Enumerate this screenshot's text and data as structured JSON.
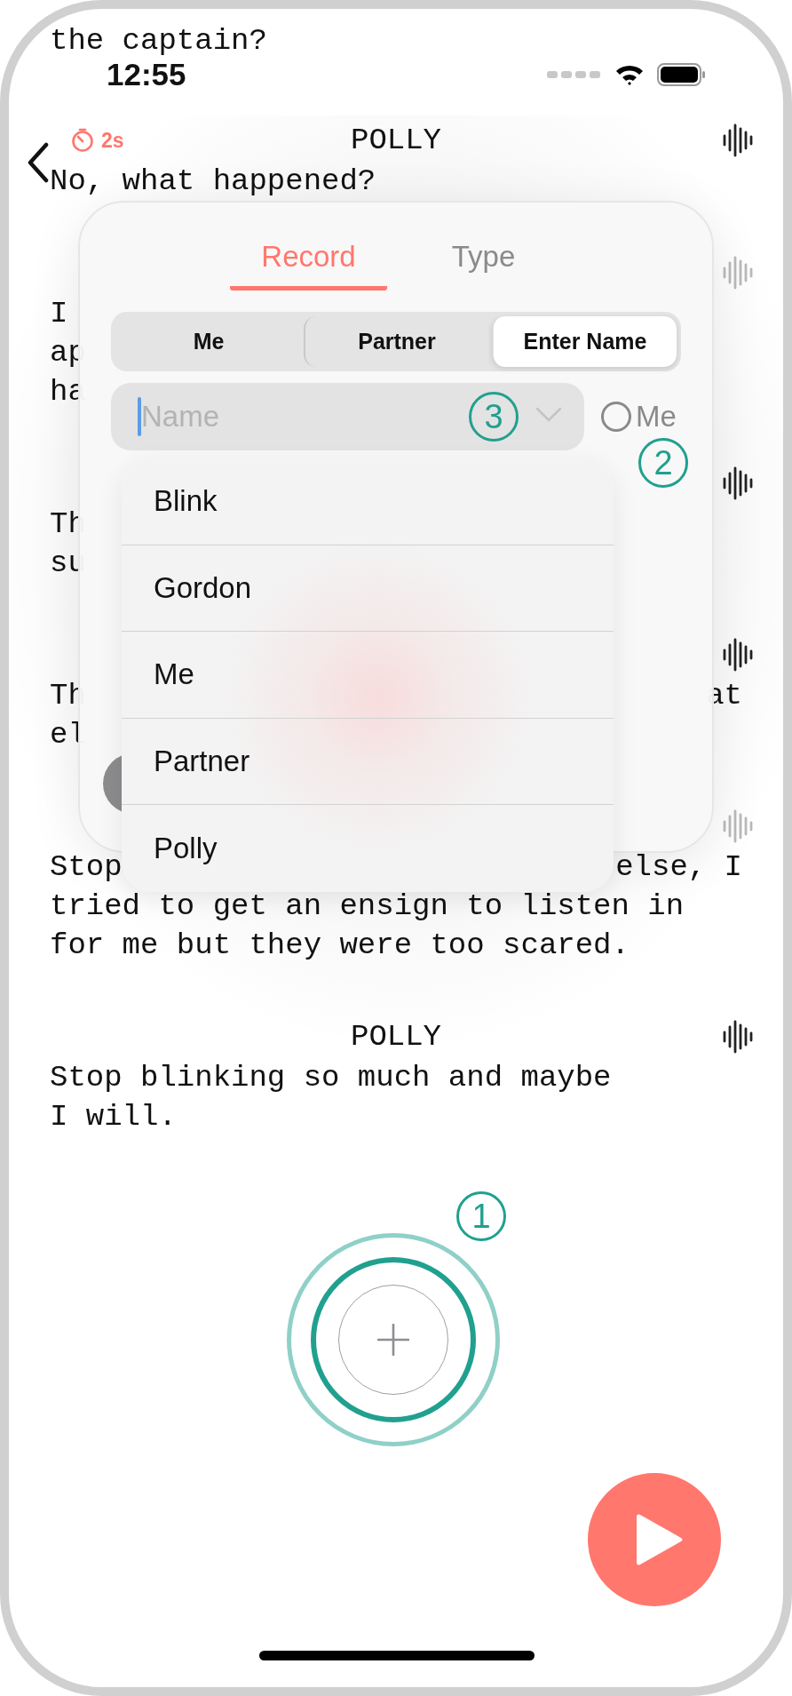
{
  "status_bar": {
    "time": "12:55"
  },
  "scrolled_line": "the captain?",
  "script": [
    {
      "speaker": "POLLY",
      "timer": "2s",
      "wave_dimmed": false,
      "lines": [
        {
          "left": "No, what happened?"
        }
      ]
    },
    {
      "wave_dimmed": true,
      "lines": [
        {
          "left": "I"
        },
        {
          "left": "ap"
        },
        {
          "left": "ha"
        }
      ]
    },
    {
      "wave_dimmed": false,
      "lines": [
        {
          "left": "Th"
        },
        {
          "left": "su"
        }
      ]
    },
    {
      "wave_dimmed": false,
      "lines": [
        {
          "left": "Th",
          "right": "at"
        },
        {
          "left": "el"
        }
      ]
    },
    {
      "wave_dimmed": true,
      "lines": [
        {
          "left": "Stop",
          "right": "else, I"
        },
        {
          "left": "tried to get an ensign to listen in"
        },
        {
          "left": "for me but they were too scared."
        }
      ]
    },
    {
      "speaker": "POLLY",
      "wave_dimmed": false,
      "lines": [
        {
          "left": "Stop blinking so much and maybe"
        },
        {
          "left": "I will."
        }
      ]
    }
  ],
  "dialog": {
    "tabs": [
      {
        "label": "Record",
        "selected": true
      },
      {
        "label": "Type",
        "selected": false
      }
    ],
    "speaker_options": [
      {
        "label": "Me",
        "selected": false
      },
      {
        "label": "Partner",
        "selected": false
      },
      {
        "label": "Enter Name",
        "selected": true
      }
    ],
    "name_field": {
      "placeholder": "Name",
      "callout": "3"
    },
    "me_toggle": {
      "label": "Me",
      "checked": false,
      "callout": "2"
    },
    "suggestions": [
      "Blink",
      "Gordon",
      "Me",
      "Partner",
      "Polly"
    ]
  },
  "record_button": {
    "callout": "1"
  }
}
